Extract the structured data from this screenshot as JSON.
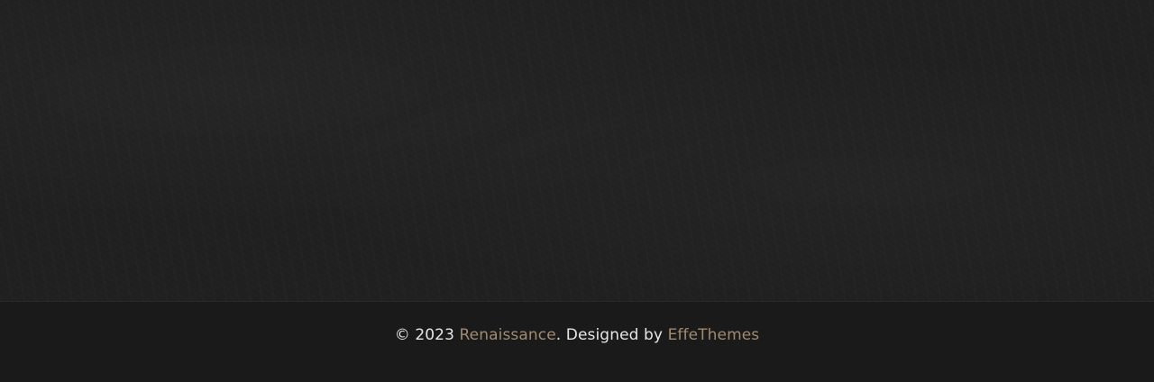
{
  "footer": {
    "copyright_prefix": "© 2023 ",
    "site_name": "Renaissance",
    "designed_by_text": ". Designed by ",
    "designer_name": "EffeThemes",
    "link_color": "#a08a70",
    "text_color": "#e6e6e6"
  }
}
